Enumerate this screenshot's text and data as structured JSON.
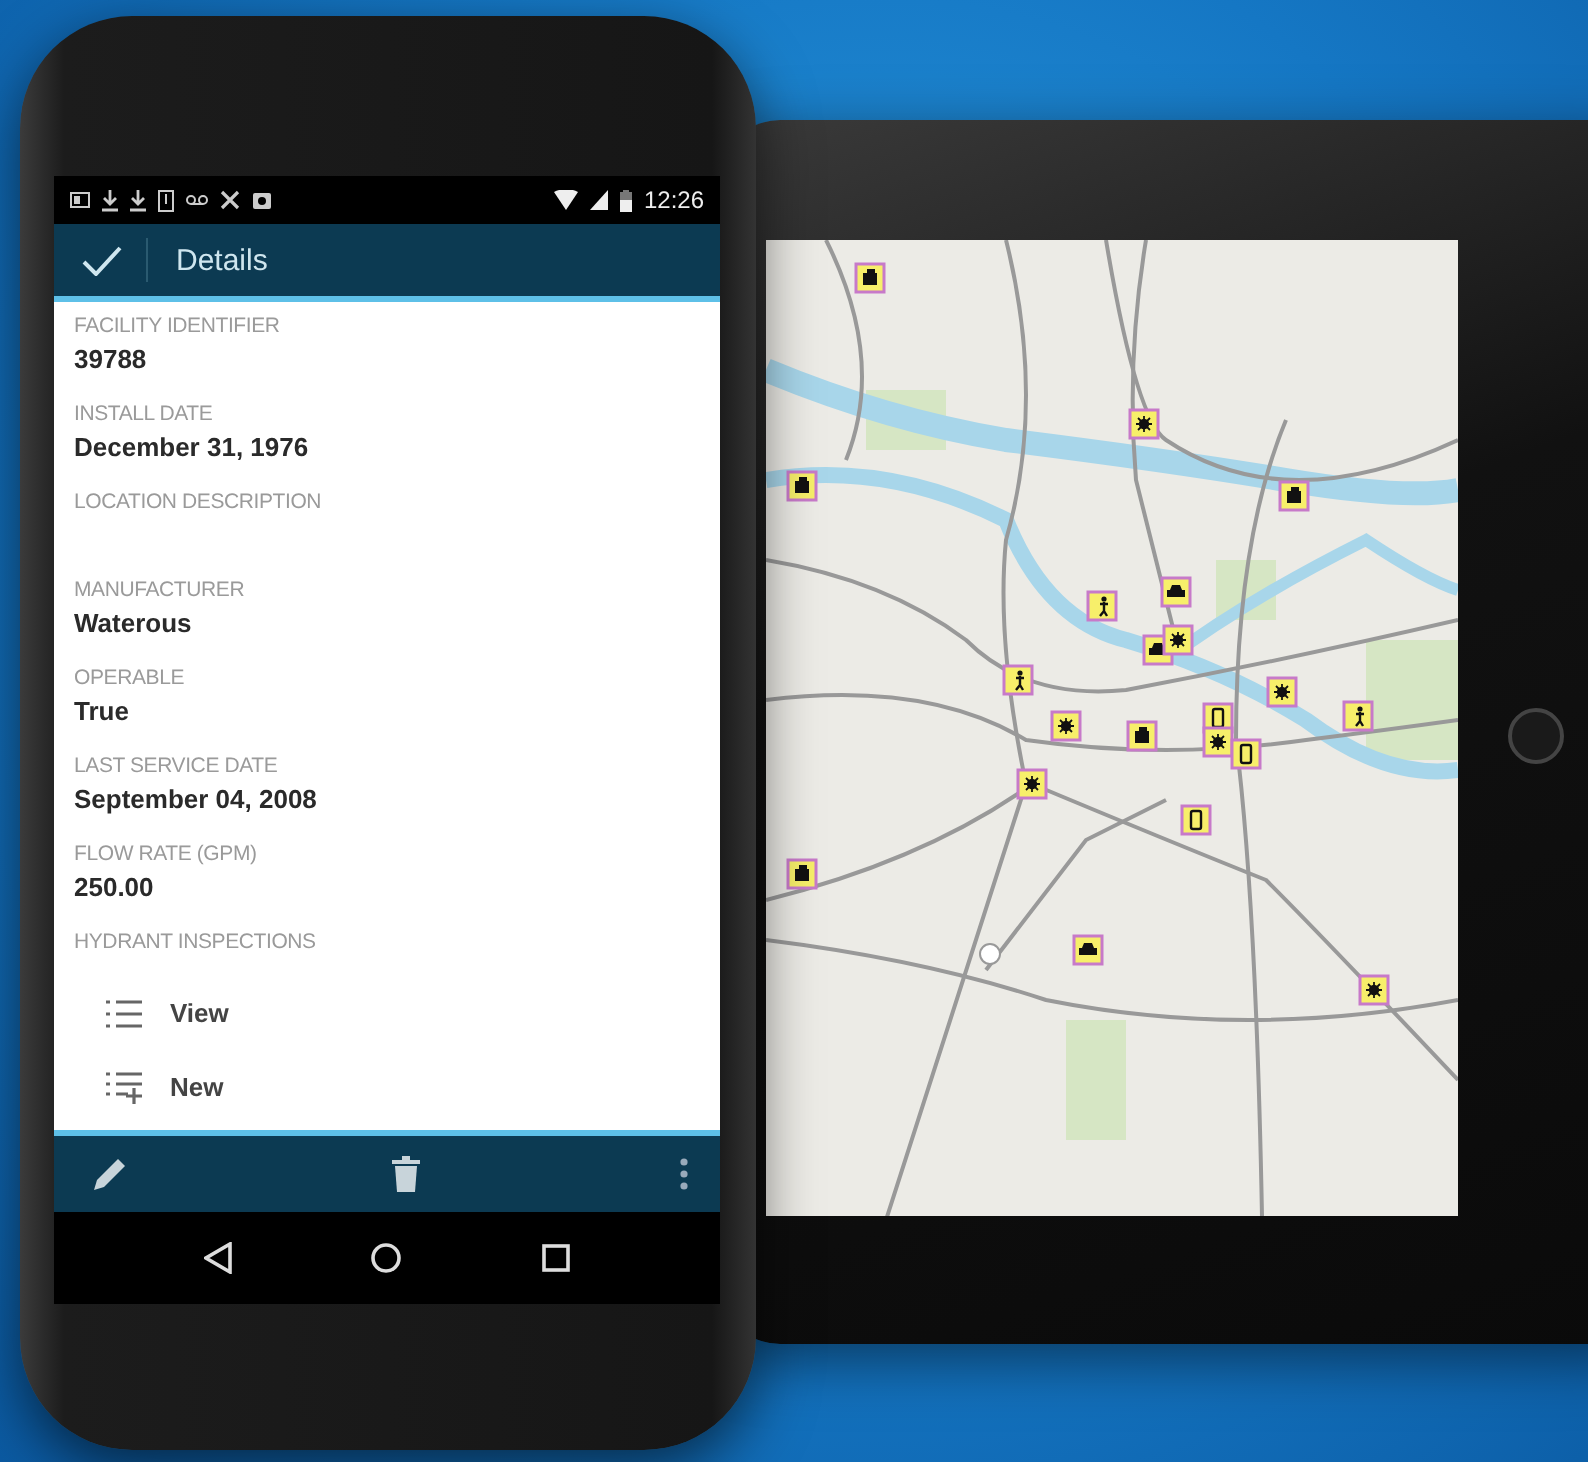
{
  "status_bar": {
    "time": "12:26"
  },
  "app_bar": {
    "title": "Details"
  },
  "fields": [
    {
      "label": "FACILITY IDENTIFIER",
      "value": "39788"
    },
    {
      "label": "INSTALL DATE",
      "value": "December 31, 1976"
    },
    {
      "label": "LOCATION DESCRIPTION"
    },
    {
      "label": "MANUFACTURER",
      "value": "Waterous"
    },
    {
      "label": "OPERABLE",
      "value": "True"
    },
    {
      "label": "LAST SERVICE DATE",
      "value": "September 04, 2008"
    },
    {
      "label": "FLOW RATE (GPM)",
      "value": "250.00"
    }
  ],
  "related": {
    "label": "HYDRANT INSPECTIONS",
    "actions": [
      {
        "kind": "view",
        "label": "View"
      },
      {
        "kind": "new",
        "label": "New"
      }
    ]
  }
}
